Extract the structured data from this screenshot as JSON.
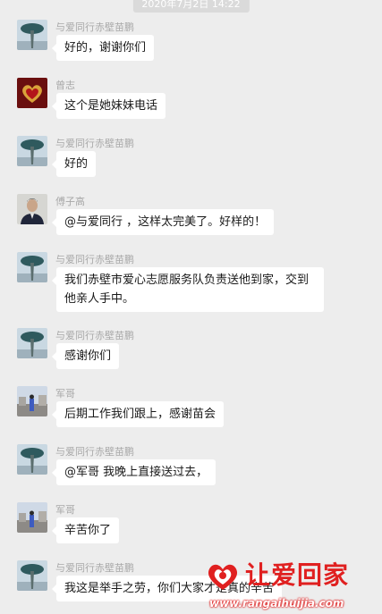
{
  "timestamp": "2020年7月2日 14:22",
  "messages": [
    {
      "sender": "与爱同行赤壁苗鹏",
      "text": "好的，谢谢你们",
      "avatar": "tree-avatar"
    },
    {
      "sender": "曾志",
      "text": "这个是她妹妹电话",
      "avatar": "heart-avatar"
    },
    {
      "sender": "与爱同行赤壁苗鹏",
      "text": "好的",
      "avatar": "tree-avatar"
    },
    {
      "sender": "傅子高",
      "text": "@与爱同行 ，这样太完美了。好样的！",
      "avatar": "person-avatar"
    },
    {
      "sender": "与爱同行赤壁苗鹏",
      "text": "我们赤壁市爱心志愿服务队负责送他到家，交到他亲人手中。",
      "avatar": "tree-avatar"
    },
    {
      "sender": "与爱同行赤壁苗鹏",
      "text": "感谢你们",
      "avatar": "tree-avatar"
    },
    {
      "sender": "军哥",
      "text": "后期工作我们跟上，感谢苗会",
      "avatar": "street-avatar"
    },
    {
      "sender": "与爱同行赤壁苗鹏",
      "text": "@军哥 我晚上直接送过去，",
      "avatar": "tree-avatar"
    },
    {
      "sender": "军哥",
      "text": "辛苦你了",
      "avatar": "street-avatar"
    },
    {
      "sender": "与爱同行赤壁苗鹏",
      "text": "我这是举手之劳，你们大家才是真的辛苦",
      "avatar": "tree-avatar"
    }
  ],
  "watermark": {
    "title": "让爱回家",
    "url": "www.rangaihuijia.com"
  }
}
